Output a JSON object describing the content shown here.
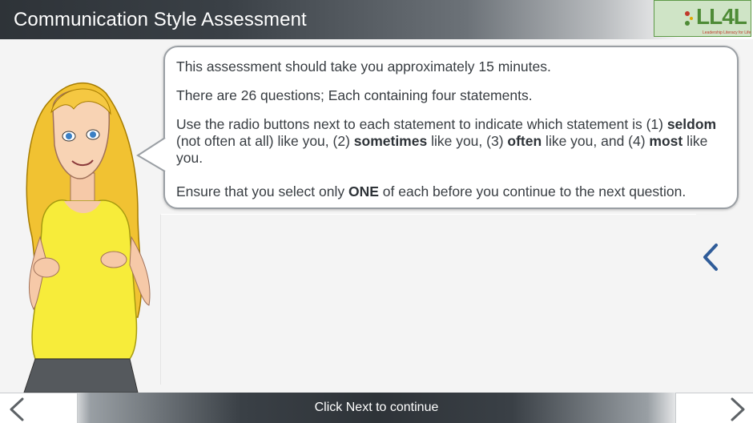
{
  "header": {
    "title": "Communication Style Assessment",
    "logo_text": "LL4L",
    "logo_tagline": "Leadership Literacy for Life"
  },
  "instructions": {
    "line1": "This assessment should take you approximately 15 minutes.",
    "line2": "There are 26 questions; Each containing four statements.",
    "line3": {
      "part1": "Use the radio buttons next to each statement to indicate which statement is (1) ",
      "seldom": "seldom",
      "part2": " (not often at all) like you, (2) ",
      "sometimes": "sometimes",
      "part3": " like you, (3) ",
      "often": "often",
      "part4": " like you, and (4) ",
      "most": "most",
      "part5": " like you."
    },
    "line4": {
      "part1": "Ensure that you select only ",
      "one": "ONE",
      "part2": " of each before you continue to the next question."
    }
  },
  "footer": {
    "text": "Click Next to continue"
  },
  "colors": {
    "header_dark": "#2e3338",
    "logo_green": "#4e8b36",
    "chevron_blue": "#2f5c99",
    "text": "#383d42"
  },
  "icons": {
    "back": "chevron-left-icon",
    "next": "chevron-right-icon",
    "side": "chevron-left-icon"
  }
}
